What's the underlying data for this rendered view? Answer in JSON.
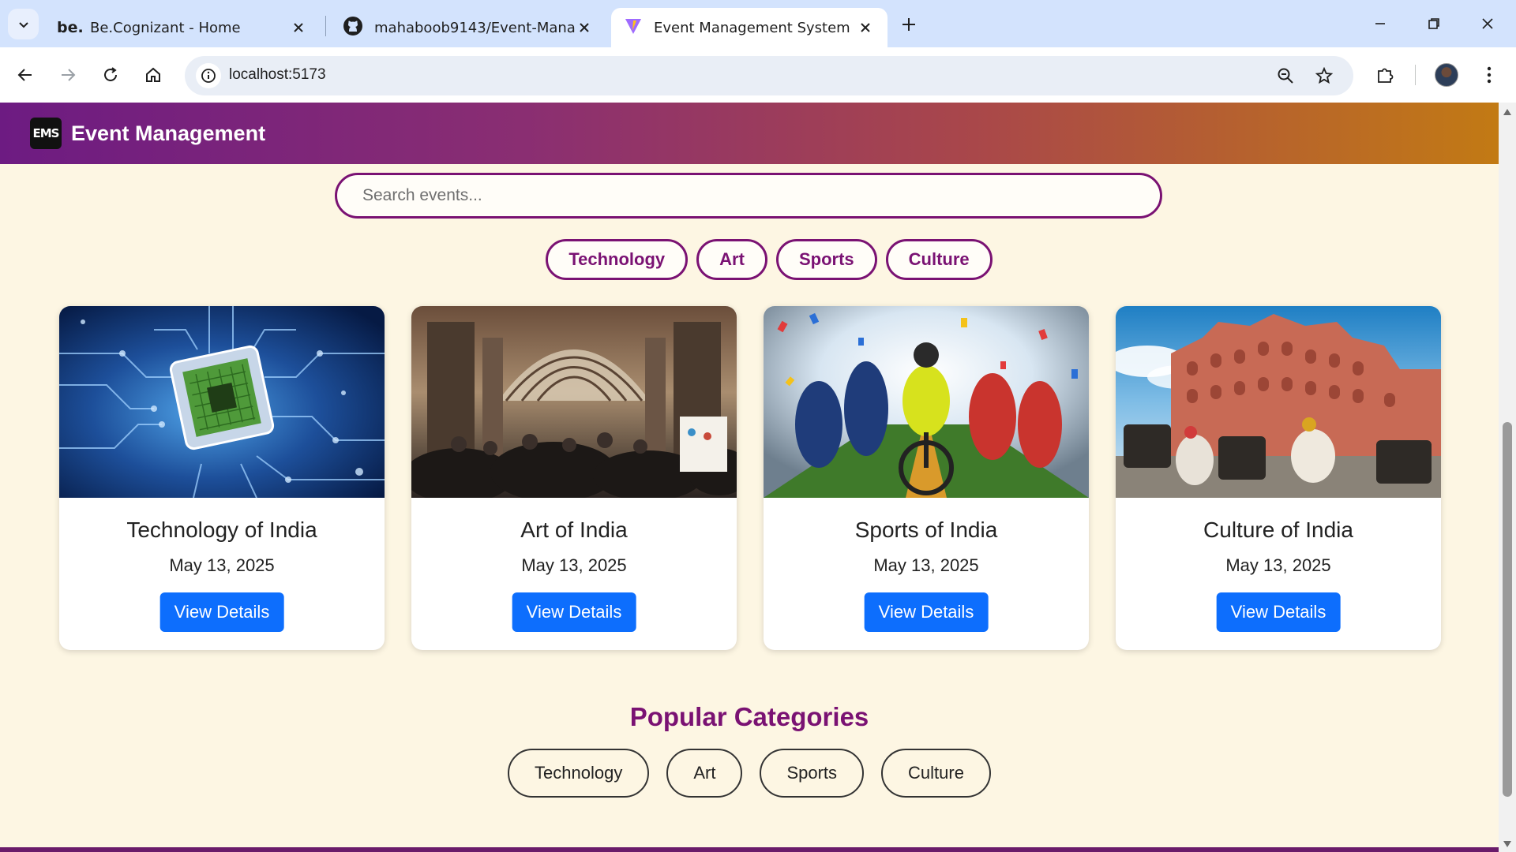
{
  "browser": {
    "tabs": [
      {
        "favicon": "be.",
        "title": "Be.Cognizant - Home"
      },
      {
        "favicon": "github-icon",
        "title": "mahaboob9143/Event-Manage"
      },
      {
        "favicon": "vite-icon",
        "title": "Event Management System"
      }
    ],
    "url": "localhost:5173"
  },
  "header": {
    "logo_text": "EMS",
    "brand": "Event Management"
  },
  "search": {
    "placeholder": "Search events..."
  },
  "filters": [
    "Technology",
    "Art",
    "Sports",
    "Culture"
  ],
  "events": [
    {
      "title": "Technology of India",
      "date": "May 13, 2025",
      "button": "View Details",
      "image": "circuit-chip-image"
    },
    {
      "title": "Art of India",
      "date": "May 13, 2025",
      "button": "View Details",
      "image": "art-gallery-hall-image"
    },
    {
      "title": "Sports of India",
      "date": "May 13, 2025",
      "button": "View Details",
      "image": "athletes-collage-image"
    },
    {
      "title": "Culture of India",
      "date": "May 13, 2025",
      "button": "View Details",
      "image": "hawa-mahal-image"
    }
  ],
  "popular": {
    "title": "Popular Categories",
    "items": [
      "Technology",
      "Art",
      "Sports",
      "Culture"
    ]
  },
  "colors": {
    "accent": "#7a1273",
    "button": "#0d6efd",
    "page_bg": "#fdf6e3",
    "header_start": "#6d1b82",
    "header_end": "#c27a14"
  }
}
